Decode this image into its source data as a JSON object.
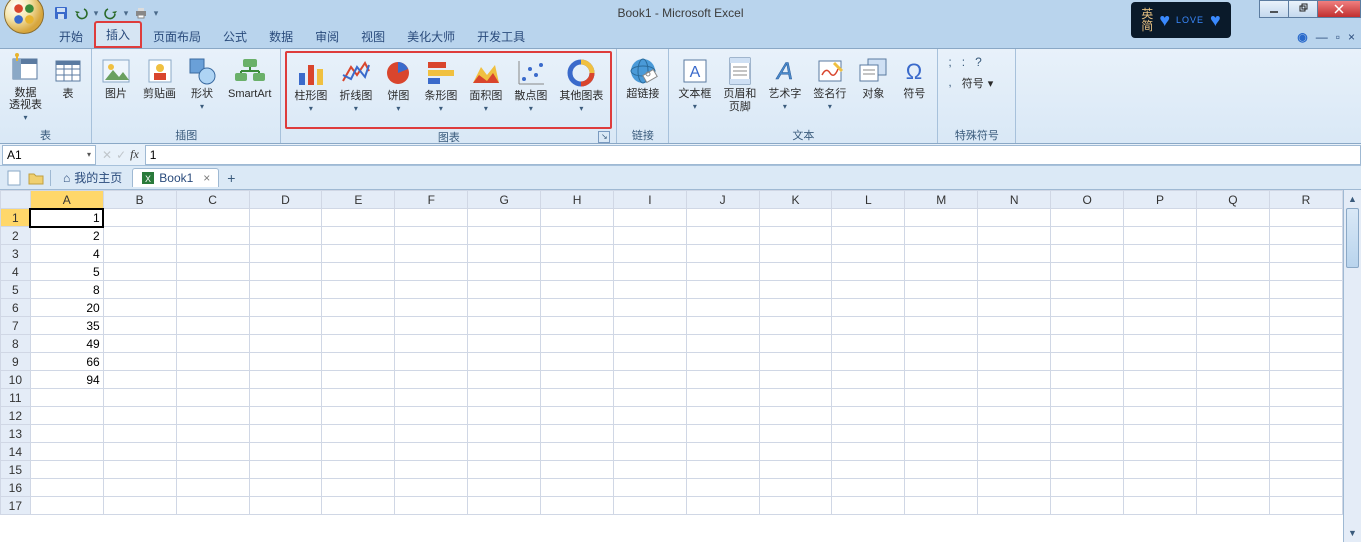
{
  "app": {
    "title": "Book1 - Microsoft Excel"
  },
  "ime": {
    "lang": "英\n简",
    "love": "LOVE"
  },
  "tabs": {
    "items": [
      "开始",
      "插入",
      "页面布局",
      "公式",
      "数据",
      "审阅",
      "视图",
      "美化大师",
      "开发工具"
    ],
    "active_index": 1
  },
  "ribbon": {
    "groups": {
      "tables": {
        "label": "表",
        "pivot": "数据\n透视表",
        "table": "表"
      },
      "illus": {
        "label": "插图",
        "pic": "图片",
        "clipart": "剪贴画",
        "shapes": "形状",
        "smartart": "SmartArt"
      },
      "charts": {
        "label": "图表",
        "column": "柱形图",
        "line": "折线图",
        "pie": "饼图",
        "bar": "条形图",
        "area": "面积图",
        "scatter": "散点图",
        "other": "其他图表"
      },
      "links": {
        "label": "链接",
        "hyperlink": "超链接"
      },
      "text": {
        "label": "文本",
        "textbox": "文本框",
        "headerfooter": "页眉和\n页脚",
        "wordart": "艺术字",
        "sigline": "签名行",
        "object": "对象",
        "symbol": "符号"
      },
      "special": {
        "label": "特殊符号",
        "sym": "符号"
      }
    }
  },
  "formula_bar": {
    "name_box": "A1",
    "value": "1"
  },
  "wb_tabs": {
    "home": "我的主页",
    "book": "Book1"
  },
  "grid": {
    "columns": [
      "A",
      "B",
      "C",
      "D",
      "E",
      "F",
      "G",
      "H",
      "I",
      "J",
      "K",
      "L",
      "M",
      "N",
      "O",
      "P",
      "Q",
      "R"
    ],
    "row_count": 17,
    "active_cell": "A1",
    "data": {
      "A1": "1",
      "A2": "2",
      "A3": "4",
      "A4": "5",
      "A5": "8",
      "A6": "20",
      "A7": "35",
      "A8": "49",
      "A9": "66",
      "A10": "94"
    }
  }
}
